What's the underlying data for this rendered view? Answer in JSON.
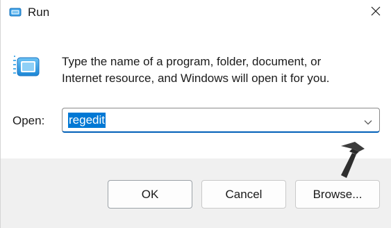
{
  "window": {
    "title": "Run",
    "close_icon": "close-icon",
    "app_icon": "run-dialog-icon"
  },
  "description": {
    "line1": "Type the name of a program, folder, document, or",
    "line2": "Internet resource, and Windows will open it for you."
  },
  "open_field": {
    "label": "Open:",
    "value": "regedit",
    "dropdown_icon": "chevron-down-icon"
  },
  "buttons": {
    "ok_label": "OK",
    "cancel_label": "Cancel",
    "browse_label": "Browse..."
  },
  "colors": {
    "accent": "#005fb8",
    "selection": "#0078d4"
  }
}
